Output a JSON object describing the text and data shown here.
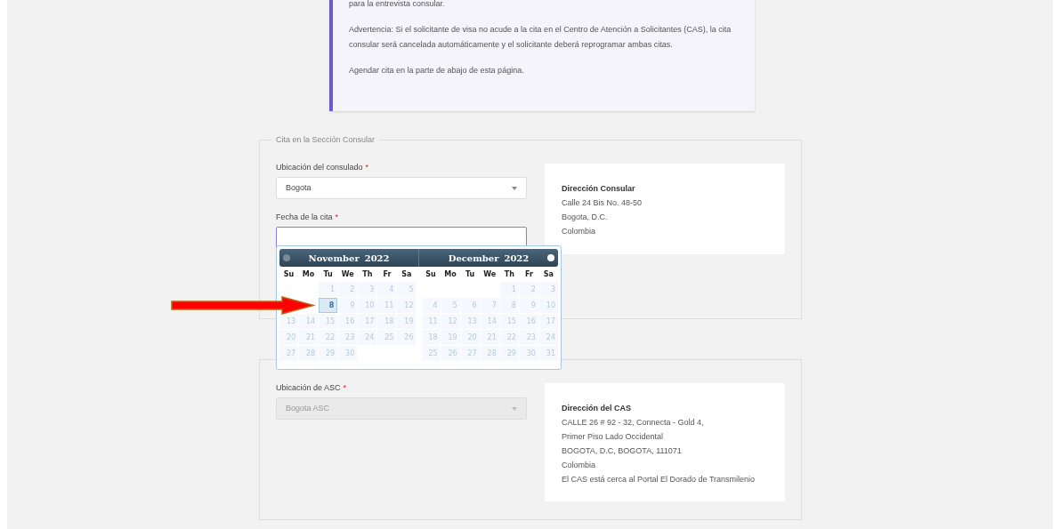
{
  "notice": {
    "paragraphs": [
      "para la entrevista consular.",
      "Advertencia: Si el solicitante de visa no acude a la cita en el Centro de Atención a Solicitantes (CAS), la cita consular será cancelada automáticamente y el solicitante deberá reprogramar ambas citas.",
      "Agendar cita en la parte de abajo de esta página."
    ]
  },
  "consular": {
    "legend": "Cita en la Sección Consular",
    "location": {
      "label": "Ubicación del consulado",
      "required": "*",
      "value": "Bogota",
      "disabled": false
    },
    "date": {
      "label": "Fecha de la cita",
      "required": "*",
      "focused": true
    },
    "address": {
      "title": "Dirección Consular",
      "lines": [
        "Calle 24 Bis No. 48-50",
        "Bogota, D.C.",
        "Colombia"
      ]
    }
  },
  "cas": {
    "location": {
      "label": "Ubicación de ASC",
      "required": "*",
      "value": "Bogota ASC",
      "disabled": true
    },
    "address": {
      "title": "Dirección del CAS",
      "lines": [
        "CALLE 26 # 92 - 32, Connecta - Gold 4,",
        "Primer Piso Lado Occidental",
        "BOGOTA, D.C, BOGOTA, 111071",
        "Colombia",
        "El CAS está cerca al Portal El Dorado de Transmilenio"
      ]
    }
  },
  "datepicker": {
    "prev_enabled": false,
    "next_enabled": true,
    "months": [
      {
        "month": "November",
        "year": "2022",
        "weekdays": [
          "Su",
          "Mo",
          "Tu",
          "We",
          "Th",
          "Fr",
          "Sa"
        ],
        "weeks": [
          [
            {
              "kind": "blank"
            },
            {
              "kind": "blank"
            },
            {
              "kind": "day",
              "day": "1",
              "today": false
            },
            {
              "kind": "day",
              "day": "2",
              "today": false
            },
            {
              "kind": "day",
              "day": "3",
              "today": false
            },
            {
              "kind": "day",
              "day": "4",
              "today": false
            },
            {
              "kind": "day",
              "day": "5",
              "today": false
            }
          ],
          [
            {
              "kind": "covered"
            },
            {
              "kind": "covered"
            },
            {
              "kind": "day",
              "day": "8",
              "today": true
            },
            {
              "kind": "day",
              "day": "9",
              "today": false
            },
            {
              "kind": "day",
              "day": "10",
              "today": false
            },
            {
              "kind": "day",
              "day": "11",
              "today": false
            },
            {
              "kind": "day",
              "day": "12",
              "today": false
            }
          ],
          [
            {
              "kind": "day",
              "day": "13",
              "today": false
            },
            {
              "kind": "day",
              "day": "14",
              "today": false
            },
            {
              "kind": "day",
              "day": "15",
              "today": false
            },
            {
              "kind": "day",
              "day": "16",
              "today": false
            },
            {
              "kind": "day",
              "day": "17",
              "today": false
            },
            {
              "kind": "day",
              "day": "18",
              "today": false
            },
            {
              "kind": "day",
              "day": "19",
              "today": false
            }
          ],
          [
            {
              "kind": "day",
              "day": "20",
              "today": false
            },
            {
              "kind": "day",
              "day": "21",
              "today": false
            },
            {
              "kind": "day",
              "day": "22",
              "today": false
            },
            {
              "kind": "day",
              "day": "23",
              "today": false
            },
            {
              "kind": "day",
              "day": "24",
              "today": false
            },
            {
              "kind": "day",
              "day": "25",
              "today": false
            },
            {
              "kind": "day",
              "day": "26",
              "today": false
            }
          ],
          [
            {
              "kind": "day",
              "day": "27",
              "today": false
            },
            {
              "kind": "day",
              "day": "28",
              "today": false
            },
            {
              "kind": "day",
              "day": "29",
              "today": false
            },
            {
              "kind": "day",
              "day": "30",
              "today": false
            },
            {
              "kind": "blank"
            },
            {
              "kind": "blank"
            },
            {
              "kind": "blank"
            }
          ]
        ]
      },
      {
        "month": "December",
        "year": "2022",
        "weekdays": [
          "Su",
          "Mo",
          "Tu",
          "We",
          "Th",
          "Fr",
          "Sa"
        ],
        "weeks": [
          [
            {
              "kind": "blank"
            },
            {
              "kind": "blank"
            },
            {
              "kind": "blank"
            },
            {
              "kind": "blank"
            },
            {
              "kind": "day",
              "day": "1",
              "today": false
            },
            {
              "kind": "day",
              "day": "2",
              "today": false
            },
            {
              "kind": "day",
              "day": "3",
              "today": false
            }
          ],
          [
            {
              "kind": "day",
              "day": "4",
              "today": false
            },
            {
              "kind": "day",
              "day": "5",
              "today": false
            },
            {
              "kind": "day",
              "day": "6",
              "today": false
            },
            {
              "kind": "day",
              "day": "7",
              "today": false
            },
            {
              "kind": "day",
              "day": "8",
              "today": false
            },
            {
              "kind": "day",
              "day": "9",
              "today": false
            },
            {
              "kind": "day",
              "day": "10",
              "today": false
            }
          ],
          [
            {
              "kind": "day",
              "day": "11",
              "today": false
            },
            {
              "kind": "day",
              "day": "12",
              "today": false
            },
            {
              "kind": "day",
              "day": "13",
              "today": false
            },
            {
              "kind": "day",
              "day": "14",
              "today": false
            },
            {
              "kind": "day",
              "day": "15",
              "today": false
            },
            {
              "kind": "day",
              "day": "16",
              "today": false
            },
            {
              "kind": "day",
              "day": "17",
              "today": false
            }
          ],
          [
            {
              "kind": "day",
              "day": "18",
              "today": false
            },
            {
              "kind": "day",
              "day": "19",
              "today": false
            },
            {
              "kind": "day",
              "day": "20",
              "today": false
            },
            {
              "kind": "day",
              "day": "21",
              "today": false
            },
            {
              "kind": "day",
              "day": "22",
              "today": false
            },
            {
              "kind": "day",
              "day": "23",
              "today": false
            },
            {
              "kind": "day",
              "day": "24",
              "today": false
            }
          ],
          [
            {
              "kind": "day",
              "day": "25",
              "today": false
            },
            {
              "kind": "day",
              "day": "26",
              "today": false
            },
            {
              "kind": "day",
              "day": "27",
              "today": false
            },
            {
              "kind": "day",
              "day": "28",
              "today": false
            },
            {
              "kind": "day",
              "day": "29",
              "today": false
            },
            {
              "kind": "day",
              "day": "30",
              "today": false
            },
            {
              "kind": "day",
              "day": "31",
              "today": false
            }
          ]
        ]
      }
    ]
  }
}
